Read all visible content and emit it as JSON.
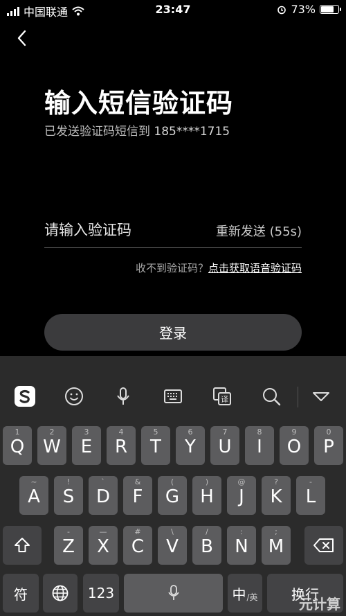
{
  "status_bar": {
    "carrier": "中国联通",
    "time": "23:47",
    "battery": "73%",
    "battery_level": 0.73
  },
  "header": {
    "title": "输入短信验证码",
    "subtitle_prefix": "已发送验证码短信到 ",
    "phone": "185****1715"
  },
  "code_field": {
    "placeholder": "请输入验证码",
    "resend_label": "重新发送 (55s)"
  },
  "help": {
    "prefix": "收不到验证码？",
    "voice_link": "点击获取语音验证码"
  },
  "login_button": {
    "label": "登录"
  },
  "keyboard": {
    "toolbar_icons": [
      "sogou-logo-icon",
      "emoji-icon",
      "microphone-icon",
      "keyboard-icon",
      "translate-icon",
      "search-icon",
      "collapse-keyboard-icon"
    ],
    "row1": [
      {
        "k": "Q",
        "h": "1"
      },
      {
        "k": "W",
        "h": "2"
      },
      {
        "k": "E",
        "h": "3"
      },
      {
        "k": "R",
        "h": "4"
      },
      {
        "k": "T",
        "h": "5"
      },
      {
        "k": "Y",
        "h": "6"
      },
      {
        "k": "U",
        "h": "7"
      },
      {
        "k": "I",
        "h": "8"
      },
      {
        "k": "O",
        "h": "9"
      },
      {
        "k": "P",
        "h": "0"
      }
    ],
    "row2": [
      {
        "k": "A",
        "h": "~"
      },
      {
        "k": "S",
        "h": "!"
      },
      {
        "k": "D",
        "h": "`"
      },
      {
        "k": "F",
        "h": "&"
      },
      {
        "k": "G",
        "h": "("
      },
      {
        "k": "H",
        "h": ")"
      },
      {
        "k": "J",
        "h": "@"
      },
      {
        "k": "K",
        "h": "?"
      },
      {
        "k": "L",
        "h": "-"
      }
    ],
    "row3": [
      {
        "k": "Z",
        "h": "-"
      },
      {
        "k": "X",
        "h": "—"
      },
      {
        "k": "C",
        "h": "#"
      },
      {
        "k": "V",
        "h": "\\"
      },
      {
        "k": "B",
        "h": "/"
      },
      {
        "k": "N",
        "h": ":"
      },
      {
        "k": "M",
        "h": ";"
      }
    ],
    "symbol_label": "符",
    "number_label": "123",
    "lang_main": "中",
    "lang_sub": "/英",
    "newline_label": "换行"
  },
  "watermark": "元计算"
}
